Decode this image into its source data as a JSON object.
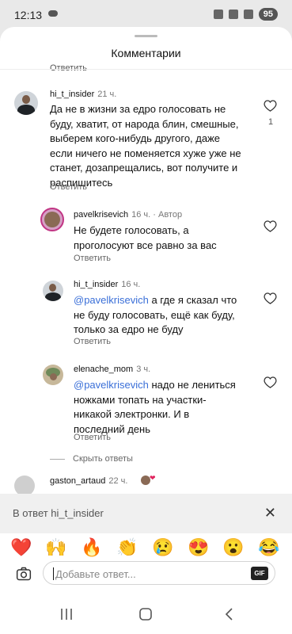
{
  "status": {
    "time": "12:13",
    "battery": "95"
  },
  "sheet": {
    "title": "Комментарии",
    "top_reply_label": "Ответить"
  },
  "comments": [
    {
      "user": "hi_t_insider",
      "time": "21 ч.",
      "text_lines": [
        "Да не в жизни за едро голосовать не",
        "буду, хватит, от народа блин, смешные,",
        "выберем кого-нибудь другого, даже",
        "если ничего не поменяется хуже уже не",
        "станет, дозапрещались, вот получите и",
        "распишитесь"
      ],
      "reply_label": "Ответить",
      "likes": "1"
    },
    {
      "user": "pavelkrisevich",
      "time": "16 ч.",
      "dot": "·",
      "author_label": "Автор",
      "text_lines": [
        "Не будете голосовать, а",
        "проголосуют все равно за вас"
      ],
      "reply_label": "Ответить"
    },
    {
      "user": "hi_t_insider",
      "time": "16 ч.",
      "mention": "@pavelkrisevich",
      "text_lines": [
        " а где я сказал что",
        "не буду голосовать, ещё как буду,",
        "только за едро не буду"
      ],
      "reply_label": "Ответить"
    },
    {
      "user": "elenache_mom",
      "time": "3 ч.",
      "mention": "@pavelkrisevich",
      "text_lines": [
        " надо не лениться",
        "ножками топать на участки-",
        "никакой электронки. И в",
        "последний день"
      ],
      "reply_label": "Ответить"
    },
    {
      "user": "gaston_artaud",
      "time": "22 ч."
    }
  ],
  "hide_replies_label": "Скрыть ответы",
  "reply_bar": {
    "label": "В ответ hi_t_insider",
    "close": "✕"
  },
  "emojis": [
    "❤️",
    "🙌",
    "🔥",
    "👏",
    "😢",
    "😍",
    "😮",
    "😂"
  ],
  "input": {
    "placeholder": "Добавьте ответ...",
    "gif_label": "GIF"
  },
  "colors": {
    "mention": "#3a6fd8",
    "sheet_bg": "#ffffff",
    "outer_bg": "#e9e9e9"
  },
  "icons": [
    "heart-icon",
    "camera-icon",
    "gif-icon",
    "close-icon",
    "recent-apps-icon",
    "home-icon",
    "back-icon"
  ]
}
